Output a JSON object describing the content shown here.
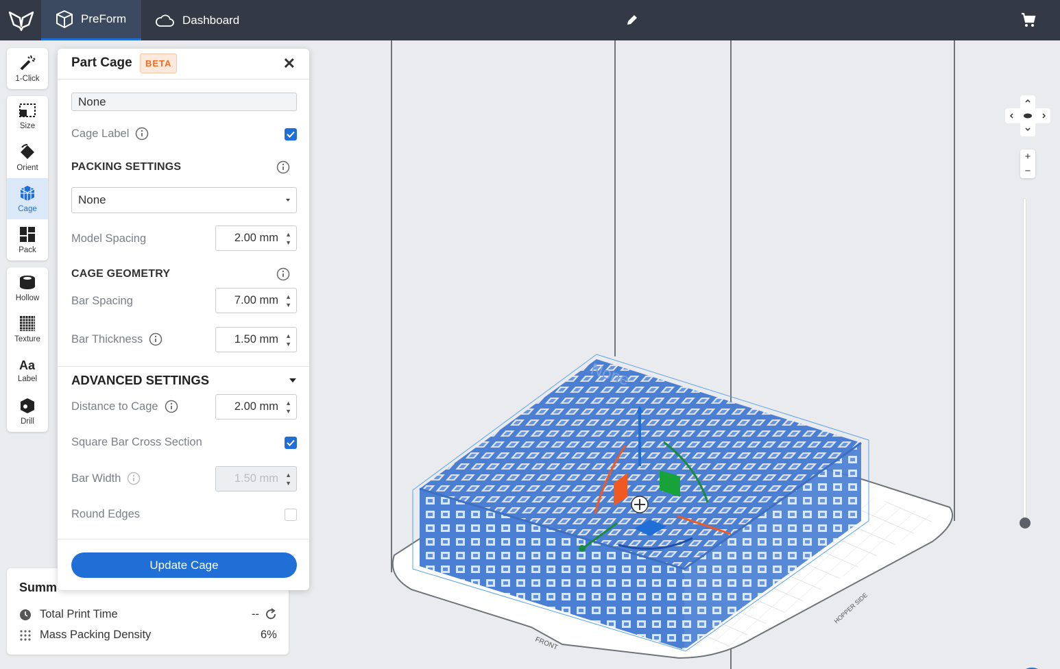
{
  "topbar": {
    "tab_preform": "PreForm",
    "tab_dashboard": "Dashboard"
  },
  "toolbar": {
    "one_click": "1-Click",
    "size": "Size",
    "orient": "Orient",
    "cage": "Cage",
    "pack": "Pack",
    "hollow": "Hollow",
    "texture": "Texture",
    "label": "Label",
    "drill": "Drill"
  },
  "panel": {
    "title": "Part Cage",
    "badge": "BETA",
    "label_text_value": "None",
    "cage_label": "Cage Label",
    "cage_label_checked": true,
    "packing_title": "PACKING SETTINGS",
    "packing_select": "None",
    "model_spacing_label": "Model Spacing",
    "model_spacing_value": "2.00 mm",
    "geometry_title": "CAGE GEOMETRY",
    "bar_spacing_label": "Bar Spacing",
    "bar_spacing_value": "7.00 mm",
    "bar_thickness_label": "Bar Thickness",
    "bar_thickness_value": "1.50 mm",
    "advanced_title": "ADVANCED SETTINGS",
    "distance_label": "Distance to Cage",
    "distance_value": "2.00 mm",
    "square_bar_label": "Square Bar Cross Section",
    "square_bar_checked": true,
    "bar_width_label": "Bar Width",
    "bar_width_value": "1.50 mm",
    "round_edges_label": "Round Edges",
    "round_edges_checked": false,
    "update_button": "Update Cage"
  },
  "summary": {
    "title": "Summ",
    "print_time_label": "Total Print Time",
    "print_time_value": "--",
    "density_label": "Mass Packing Density",
    "density_value": "6%"
  },
  "viewport": {
    "build_front_label": "FRONT",
    "build_side_label": "HOPPER SIDE",
    "model_label": "None",
    "cage_color": "#4a7fd4",
    "accent": "#1f6fd6"
  }
}
